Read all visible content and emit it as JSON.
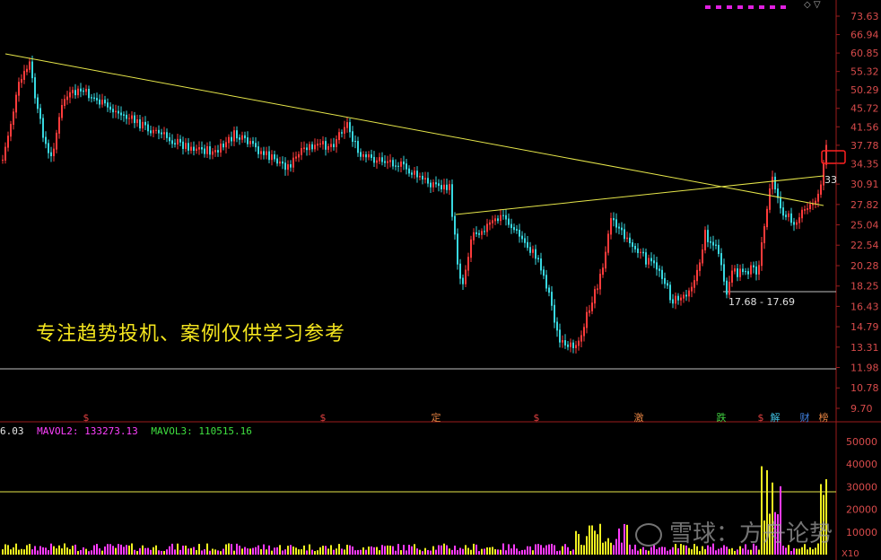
{
  "price_axis_labels": [
    "73.63",
    "66.94",
    "60.85",
    "55.32",
    "50.29",
    "45.72",
    "41.56",
    "37.78",
    "34.35",
    "30.91",
    "27.82",
    "25.04",
    "22.54",
    "20.28",
    "18.25",
    "16.43",
    "14.79",
    "13.31",
    "11.98",
    "10.78",
    "9.70"
  ],
  "price_axis_values": [
    73.63,
    66.94,
    60.85,
    55.32,
    50.29,
    45.72,
    41.56,
    37.78,
    34.35,
    30.91,
    27.82,
    25.04,
    22.54,
    20.28,
    18.25,
    16.43,
    14.79,
    13.31,
    11.98,
    10.78,
    9.7
  ],
  "volume_axis_labels": [
    "50000",
    "40000",
    "30000",
    "20000",
    "10000"
  ],
  "volume_axis_values": [
    50000,
    40000,
    30000,
    20000,
    10000
  ],
  "volume_unit": "X10",
  "caption": "专注趋势投机、案例仅供学习参考",
  "range_label": "17.68 - 17.69",
  "level_marker": "33",
  "mavol": {
    "mavol1": "6.03",
    "mavol2": "MAVOL2: 133273.13",
    "mavol3": "MAVOL3: 110515.16"
  },
  "event_markers": [
    {
      "label": "$",
      "color": "#e04040"
    },
    {
      "label": "$",
      "color": "#e04040"
    },
    {
      "label": "定",
      "color": "#e08040"
    },
    {
      "label": "$",
      "color": "#e04040"
    },
    {
      "label": "激",
      "color": "#e08040"
    },
    {
      "label": "跌",
      "color": "#40d040"
    },
    {
      "label": "$",
      "color": "#e04040"
    },
    {
      "label": "解",
      "color": "#40c0e0"
    },
    {
      "label": "财",
      "color": "#4080e0"
    },
    {
      "label": "榜",
      "color": "#e08040"
    }
  ],
  "watermark": "雪球：方舟论势",
  "colors": {
    "up": "#ff3b3b",
    "down": "#38d8e0",
    "trendline": "#e6e64a",
    "volume_up": "#f0f020",
    "volume_down": "#ff3bff",
    "grid_line": "#9c1c1c",
    "axis_text": "#d84b4b"
  },
  "chart_data": {
    "type": "candlestick",
    "price_scale": "log",
    "y_range": [
      9.7,
      73.63
    ],
    "trendlines": [
      {
        "from_price": 60.85,
        "to_price": 28.0,
        "type": "descending"
      },
      {
        "from_price": 26.3,
        "to_price": 32.5,
        "type": "ascending"
      }
    ],
    "horizontal_levels": [
      18.25,
      11.98
    ],
    "volume_reference": 27000
  }
}
